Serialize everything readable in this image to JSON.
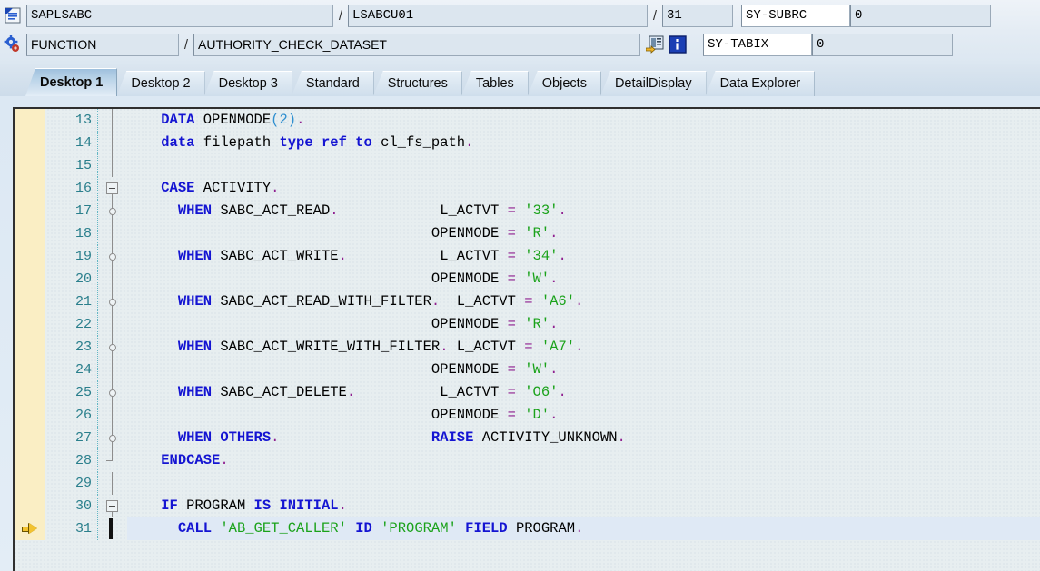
{
  "header": {
    "program_icon": "program-document-icon",
    "type_icon": "gear-function-icon",
    "program_name": "SAPLSABC",
    "include_name": "LSABCU01",
    "line_number": "31",
    "object_type": "FUNCTION",
    "object_name": "AUTHORITY_CHECK_DATASET",
    "goto_icon": "goto-source-icon",
    "info_icon": "info-icon",
    "separator": "/",
    "sy_subrc_label": "SY-SUBRC",
    "sy_subrc_value": "0",
    "sy_tabix_label": "SY-TABIX",
    "sy_tabix_value": "0"
  },
  "tabs": [
    {
      "label": "Desktop 1",
      "active": true
    },
    {
      "label": "Desktop 2",
      "active": false
    },
    {
      "label": "Desktop 3",
      "active": false
    },
    {
      "label": "Standard",
      "active": false
    },
    {
      "label": "Structures",
      "active": false
    },
    {
      "label": "Tables",
      "active": false
    },
    {
      "label": "Objects",
      "active": false
    },
    {
      "label": "DetailDisplay",
      "active": false
    },
    {
      "label": "Data Explorer",
      "active": false
    }
  ],
  "editor": {
    "current_line": "31",
    "lines": [
      {
        "num": "13",
        "fold": "line",
        "current": false,
        "text": "    DATA OPENMODE(2).",
        "tokens": [
          {
            "t": "    ",
            "c": "id"
          },
          {
            "t": "DATA",
            "c": "kw"
          },
          {
            "t": " OPENMODE",
            "c": "id"
          },
          {
            "t": "(",
            "c": "num"
          },
          {
            "t": "2",
            "c": "num"
          },
          {
            "t": ")",
            "c": "num"
          },
          {
            "t": ".",
            "c": "op"
          }
        ]
      },
      {
        "num": "14",
        "fold": "line",
        "current": false,
        "text": "    data filepath type ref to cl_fs_path.",
        "tokens": [
          {
            "t": "    ",
            "c": "id"
          },
          {
            "t": "data",
            "c": "kw"
          },
          {
            "t": " filepath ",
            "c": "id"
          },
          {
            "t": "type ref to",
            "c": "kw"
          },
          {
            "t": " cl_fs_path",
            "c": "id"
          },
          {
            "t": ".",
            "c": "op"
          }
        ]
      },
      {
        "num": "15",
        "fold": "line",
        "current": false,
        "text": "",
        "tokens": []
      },
      {
        "num": "16",
        "fold": "box",
        "current": false,
        "text": "    CASE ACTIVITY.",
        "tokens": [
          {
            "t": "    ",
            "c": "id"
          },
          {
            "t": "CASE",
            "c": "kw"
          },
          {
            "t": " ACTIVITY",
            "c": "id"
          },
          {
            "t": ".",
            "c": "op"
          }
        ]
      },
      {
        "num": "17",
        "fold": "dot",
        "current": false,
        "text": "      WHEN SABC_ACT_READ.            L_ACTVT = '33'.",
        "tokens": [
          {
            "t": "      ",
            "c": "id"
          },
          {
            "t": "WHEN",
            "c": "kw"
          },
          {
            "t": " SABC_ACT_READ",
            "c": "id"
          },
          {
            "t": ".",
            "c": "op"
          },
          {
            "t": "            L_ACTVT ",
            "c": "id"
          },
          {
            "t": "=",
            "c": "op"
          },
          {
            "t": " ",
            "c": "id"
          },
          {
            "t": "'33'",
            "c": "lit"
          },
          {
            "t": ".",
            "c": "op"
          }
        ]
      },
      {
        "num": "18",
        "fold": "line",
        "current": false,
        "text": "                                    OPENMODE = 'R'.",
        "tokens": [
          {
            "t": "                                    OPENMODE ",
            "c": "id"
          },
          {
            "t": "=",
            "c": "op"
          },
          {
            "t": " ",
            "c": "id"
          },
          {
            "t": "'R'",
            "c": "lit"
          },
          {
            "t": ".",
            "c": "op"
          }
        ]
      },
      {
        "num": "19",
        "fold": "dot",
        "current": false,
        "text": "      WHEN SABC_ACT_WRITE.           L_ACTVT = '34'.",
        "tokens": [
          {
            "t": "      ",
            "c": "id"
          },
          {
            "t": "WHEN",
            "c": "kw"
          },
          {
            "t": " SABC_ACT_WRITE",
            "c": "id"
          },
          {
            "t": ".",
            "c": "op"
          },
          {
            "t": "           L_ACTVT ",
            "c": "id"
          },
          {
            "t": "=",
            "c": "op"
          },
          {
            "t": " ",
            "c": "id"
          },
          {
            "t": "'34'",
            "c": "lit"
          },
          {
            "t": ".",
            "c": "op"
          }
        ]
      },
      {
        "num": "20",
        "fold": "line",
        "current": false,
        "text": "                                    OPENMODE = 'W'.",
        "tokens": [
          {
            "t": "                                    OPENMODE ",
            "c": "id"
          },
          {
            "t": "=",
            "c": "op"
          },
          {
            "t": " ",
            "c": "id"
          },
          {
            "t": "'W'",
            "c": "lit"
          },
          {
            "t": ".",
            "c": "op"
          }
        ]
      },
      {
        "num": "21",
        "fold": "dot",
        "current": false,
        "text": "      WHEN SABC_ACT_READ_WITH_FILTER.  L_ACTVT = 'A6'.",
        "tokens": [
          {
            "t": "      ",
            "c": "id"
          },
          {
            "t": "WHEN",
            "c": "kw"
          },
          {
            "t": " SABC_ACT_READ_WITH_FILTER",
            "c": "id"
          },
          {
            "t": ".",
            "c": "op"
          },
          {
            "t": "  L_ACTVT ",
            "c": "id"
          },
          {
            "t": "=",
            "c": "op"
          },
          {
            "t": " ",
            "c": "id"
          },
          {
            "t": "'A6'",
            "c": "lit"
          },
          {
            "t": ".",
            "c": "op"
          }
        ]
      },
      {
        "num": "22",
        "fold": "line",
        "current": false,
        "text": "                                    OPENMODE = 'R'.",
        "tokens": [
          {
            "t": "                                    OPENMODE ",
            "c": "id"
          },
          {
            "t": "=",
            "c": "op"
          },
          {
            "t": " ",
            "c": "id"
          },
          {
            "t": "'R'",
            "c": "lit"
          },
          {
            "t": ".",
            "c": "op"
          }
        ]
      },
      {
        "num": "23",
        "fold": "dot",
        "current": false,
        "text": "      WHEN SABC_ACT_WRITE_WITH_FILTER. L_ACTVT = 'A7'.",
        "tokens": [
          {
            "t": "      ",
            "c": "id"
          },
          {
            "t": "WHEN",
            "c": "kw"
          },
          {
            "t": " SABC_ACT_WRITE_WITH_FILTER",
            "c": "id"
          },
          {
            "t": ".",
            "c": "op"
          },
          {
            "t": " L_ACTVT ",
            "c": "id"
          },
          {
            "t": "=",
            "c": "op"
          },
          {
            "t": " ",
            "c": "id"
          },
          {
            "t": "'A7'",
            "c": "lit"
          },
          {
            "t": ".",
            "c": "op"
          }
        ]
      },
      {
        "num": "24",
        "fold": "line",
        "current": false,
        "text": "                                    OPENMODE = 'W'.",
        "tokens": [
          {
            "t": "                                    OPENMODE ",
            "c": "id"
          },
          {
            "t": "=",
            "c": "op"
          },
          {
            "t": " ",
            "c": "id"
          },
          {
            "t": "'W'",
            "c": "lit"
          },
          {
            "t": ".",
            "c": "op"
          }
        ]
      },
      {
        "num": "25",
        "fold": "dot",
        "current": false,
        "text": "      WHEN SABC_ACT_DELETE.          L_ACTVT = 'O6'.",
        "tokens": [
          {
            "t": "      ",
            "c": "id"
          },
          {
            "t": "WHEN",
            "c": "kw"
          },
          {
            "t": " SABC_ACT_DELETE",
            "c": "id"
          },
          {
            "t": ".",
            "c": "op"
          },
          {
            "t": "          L_ACTVT ",
            "c": "id"
          },
          {
            "t": "=",
            "c": "op"
          },
          {
            "t": " ",
            "c": "id"
          },
          {
            "t": "'O6'",
            "c": "lit"
          },
          {
            "t": ".",
            "c": "op"
          }
        ]
      },
      {
        "num": "26",
        "fold": "line",
        "current": false,
        "text": "                                    OPENMODE = 'D'.",
        "tokens": [
          {
            "t": "                                    OPENMODE ",
            "c": "id"
          },
          {
            "t": "=",
            "c": "op"
          },
          {
            "t": " ",
            "c": "id"
          },
          {
            "t": "'D'",
            "c": "lit"
          },
          {
            "t": ".",
            "c": "op"
          }
        ]
      },
      {
        "num": "27",
        "fold": "dot",
        "current": false,
        "text": "      WHEN OTHERS.                  RAISE ACTIVITY_UNKNOWN.",
        "tokens": [
          {
            "t": "      ",
            "c": "id"
          },
          {
            "t": "WHEN OTHERS",
            "c": "kw"
          },
          {
            "t": ".",
            "c": "op"
          },
          {
            "t": "                  ",
            "c": "id"
          },
          {
            "t": "RAISE",
            "c": "kw"
          },
          {
            "t": " ACTIVITY_UNKNOWN",
            "c": "id"
          },
          {
            "t": ".",
            "c": "op"
          }
        ]
      },
      {
        "num": "28",
        "fold": "end",
        "current": false,
        "text": "    ENDCASE.",
        "tokens": [
          {
            "t": "    ",
            "c": "id"
          },
          {
            "t": "ENDCASE",
            "c": "kw"
          },
          {
            "t": ".",
            "c": "op"
          }
        ]
      },
      {
        "num": "29",
        "fold": "line",
        "current": false,
        "text": "",
        "tokens": []
      },
      {
        "num": "30",
        "fold": "box",
        "current": false,
        "text": "    IF PROGRAM IS INITIAL.",
        "tokens": [
          {
            "t": "    ",
            "c": "id"
          },
          {
            "t": "IF",
            "c": "kw"
          },
          {
            "t": " PROGRAM ",
            "c": "id"
          },
          {
            "t": "IS INITIAL",
            "c": "kw"
          },
          {
            "t": ".",
            "c": "op"
          }
        ]
      },
      {
        "num": "31",
        "fold": "cursor",
        "current": true,
        "text": "      CALL 'AB_GET_CALLER' ID 'PROGRAM' FIELD PROGRAM.",
        "tokens": [
          {
            "t": "      ",
            "c": "id"
          },
          {
            "t": "CALL",
            "c": "kw"
          },
          {
            "t": " ",
            "c": "id"
          },
          {
            "t": "'AB_GET_CALLER'",
            "c": "lit"
          },
          {
            "t": " ",
            "c": "id"
          },
          {
            "t": "ID",
            "c": "kw"
          },
          {
            "t": " ",
            "c": "id"
          },
          {
            "t": "'PROGRAM'",
            "c": "lit"
          },
          {
            "t": " ",
            "c": "id"
          },
          {
            "t": "FIELD",
            "c": "kw"
          },
          {
            "t": " PROGRAM",
            "c": "id"
          },
          {
            "t": ".",
            "c": "op"
          }
        ]
      }
    ]
  }
}
